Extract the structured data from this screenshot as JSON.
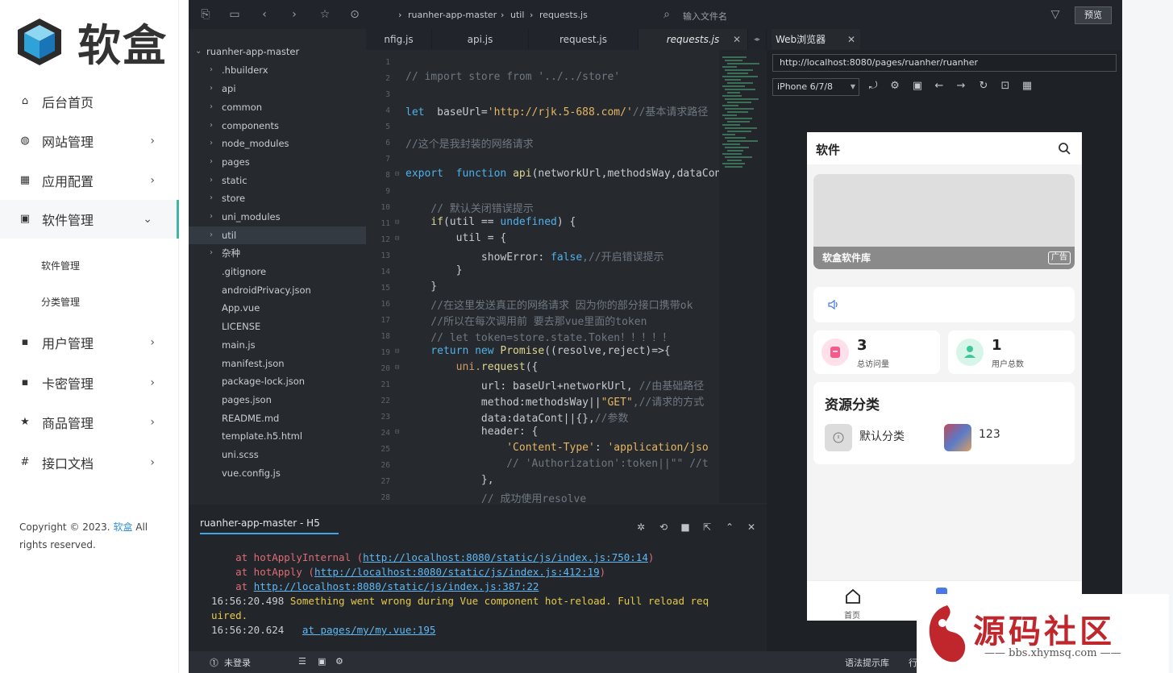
{
  "admin": {
    "logo_text": "软盒",
    "nav": [
      {
        "label": "后台首页",
        "icon": "home-icon",
        "has_arrow": false
      },
      {
        "label": "网站管理",
        "icon": "globe-icon",
        "has_arrow": true
      },
      {
        "label": "应用配置",
        "icon": "grid-icon",
        "has_arrow": true
      },
      {
        "label": "软件管理",
        "icon": "box-icon",
        "has_arrow": true,
        "expanded": true
      },
      {
        "label": "用户管理",
        "icon": "user-card-icon",
        "has_arrow": true
      },
      {
        "label": "卡密管理",
        "icon": "card-icon",
        "has_arrow": true
      },
      {
        "label": "商品管理",
        "icon": "star-icon",
        "has_arrow": true
      },
      {
        "label": "接口文档",
        "icon": "hash-icon",
        "has_arrow": true
      }
    ],
    "sub_items": [
      "软件管理",
      "分类管理"
    ],
    "copyright_prefix": "Copyright © 2023. ",
    "copyright_brand": "软盒",
    "copyright_suffix": " All rights reserved."
  },
  "editor": {
    "breadcrumb": [
      "ruanher-app-master",
      "util",
      "requests.js"
    ],
    "file_search_placeholder": "输入文件名",
    "preview_label": "预览",
    "tree_root": "ruanher-app-master",
    "folders": [
      ".hbuilderx",
      "api",
      "common",
      "components",
      "node_modules",
      "pages",
      "static",
      "store",
      "uni_modules",
      "util",
      "杂种"
    ],
    "files": [
      ".gitignore",
      "androidPrivacy.json",
      "App.vue",
      "LICENSE",
      "main.js",
      "manifest.json",
      "package-lock.json",
      "pages.json",
      "README.md",
      "template.h5.html",
      "uni.scss",
      "vue.config.js"
    ],
    "tabs": [
      "nfig.js",
      "api.js",
      "request.js",
      "requests.js"
    ],
    "active_tab": "requests.js",
    "line_numbers": [
      "1",
      "2",
      "3",
      "4",
      "5",
      "6",
      "7",
      "8",
      "9",
      "10",
      "11",
      "12",
      "13",
      "14",
      "15",
      "16",
      "17",
      "18",
      "19",
      "20",
      "21",
      "22",
      "23",
      "24",
      "25",
      "26",
      "27",
      "28"
    ],
    "code": {
      "l2": "// import store from '../../store'",
      "l4_kw": "let",
      "l4_a": "  baseUrl=",
      "l4_str": "'http://rjk.5-688.com/'",
      "l4_com": "//基本请求路径",
      "l6": "//这个是我封装的网络请求",
      "l8_kw": "export",
      "l8_kw2": "  function",
      "l8_fn": " api",
      "l8_rest": "(networkUrl,methodsWay,dataCont",
      "l10": "    // 默认关闭错误提示",
      "l11_a": "    if",
      "l11_b": "(util == ",
      "l11_c": "undefined",
      "l11_d": ") {",
      "l12": "        util = {",
      "l13_a": "            showError: ",
      "l13_b": "false",
      "l13_c": ",//开启错误提示",
      "l14": "        }",
      "l15": "    }",
      "l16": "    //在这里发送真正的网络请求 因为你的部分接口携带ok",
      "l17": "    //所以在每次调用前 要去那vue里面的token",
      "l18": "    // let token=store.state.Token！！！！！",
      "l19_a": "    return new ",
      "l19_b": "Promise",
      "l19_c": "((resolve,reject)=>{",
      "l20_a": "        uni.",
      "l20_b": "request",
      "l20_c": "({",
      "l21_a": "            url: baseUrl+networkUrl, ",
      "l21_b": "//由基础路径",
      "l22_a": "            method:methodsWay||",
      "l22_b": "\"GET\"",
      "l22_c": ",//请求的方式",
      "l23_a": "            data:dataCont||{},",
      "l23_b": "//参数",
      "l24": "            header: {",
      "l25_a": "                ",
      "l25_b": "'Content-Type'",
      "l25_c": ": ",
      "l25_d": "'application/jso",
      "l26": "                // 'Authorization':token||\"\" //t",
      "l27": "            },",
      "l28": "            // 成功使用resolve"
    },
    "console_tab": "ruanher-app-master - H5",
    "console": {
      "r1_pre": "    at hotApplyInternal (",
      "r1_link": "http://localhost:8080/static/js/index.js:750:14",
      "r1_post": ")",
      "r2_pre": "    at hotApply (",
      "r2_link": "http://localhost:8080/static/js/index.js:412:19",
      "r2_post": ")",
      "r3_pre": "    at ",
      "r3_link": "http://localhost:8080/static/js/index.js:387:22",
      "r4_time": "16:56:20.498 ",
      "r4_msg": "Something went wrong during Vue component hot-reload. Full reload req",
      "r5_msg": "uired.",
      "r6_time": "16:56:20.624   ",
      "r6_link": "at pages/my/my.vue:195"
    },
    "status": {
      "login": "未登录",
      "syntax_hint": "语法提示库",
      "row_col": "行"
    }
  },
  "browser": {
    "tab_label": "Web浏览器",
    "url": "http://localhost:8080/pages/ruanher/ruanher",
    "device": "iPhone 6/7/8"
  },
  "phone": {
    "title": "软件",
    "banner_label": "软盒软件库",
    "banner_ad": "广告",
    "stats": [
      {
        "value": "3",
        "label": "总访问量",
        "color": "#f25b8c",
        "bg": "#fde0ea"
      },
      {
        "value": "1",
        "label": "用户总数",
        "color": "#3dc79a",
        "bg": "#d8f5ea"
      }
    ],
    "category_title": "资源分类",
    "categories": [
      "默认分类",
      "123"
    ],
    "tab_home": "首页"
  },
  "watermark": {
    "text": "源码社区",
    "url": "—— bbs.xhymsq.com ——"
  }
}
